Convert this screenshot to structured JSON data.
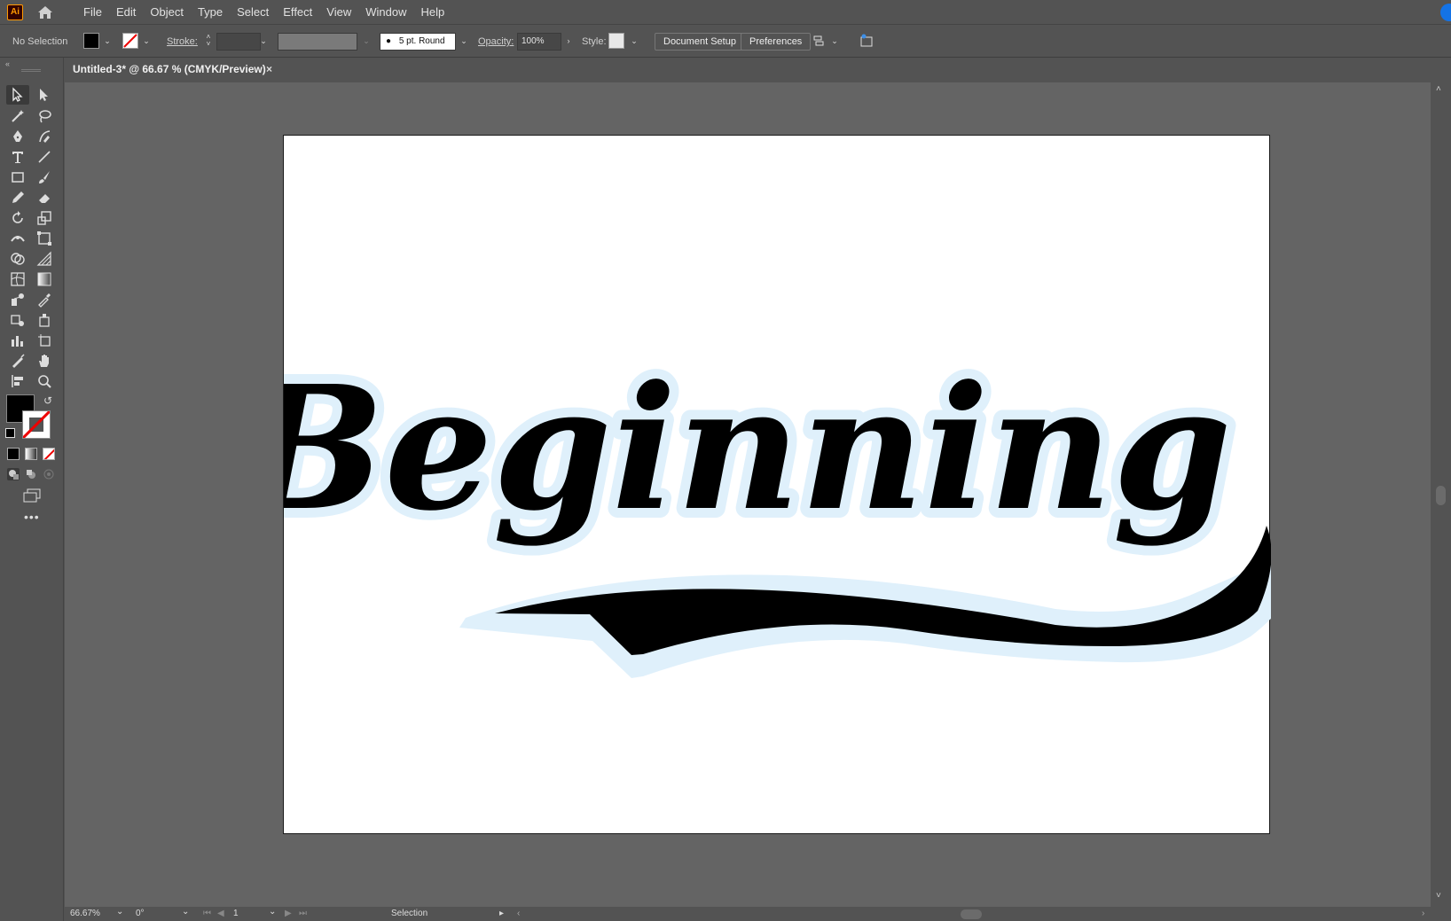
{
  "app": {
    "logo_text": "Ai"
  },
  "menu": [
    "File",
    "Edit",
    "Object",
    "Type",
    "Select",
    "Effect",
    "View",
    "Window",
    "Help"
  ],
  "control_bar": {
    "selection_status": "No Selection",
    "stroke_label": "Stroke:",
    "brush_value": "5 pt. Round",
    "opacity_label": "Opacity:",
    "opacity_value": "100%",
    "style_label": "Style:",
    "document_setup_label": "Document Setup",
    "preferences_label": "Preferences"
  },
  "document_tab": {
    "title": "Untitled-3* @ 66.67 % (CMYK/Preview)",
    "close_glyph": "×"
  },
  "artwork": {
    "text": "Beginning",
    "fill_color": "#000000",
    "outline_color": "#dff0fb"
  },
  "status_bar": {
    "zoom": "66.67%",
    "rotation": "0°",
    "artboard_number": "1",
    "tool_name": "Selection"
  },
  "colors": {
    "accent": "#1473e6",
    "canvas": "#646464",
    "chrome": "#535353"
  }
}
